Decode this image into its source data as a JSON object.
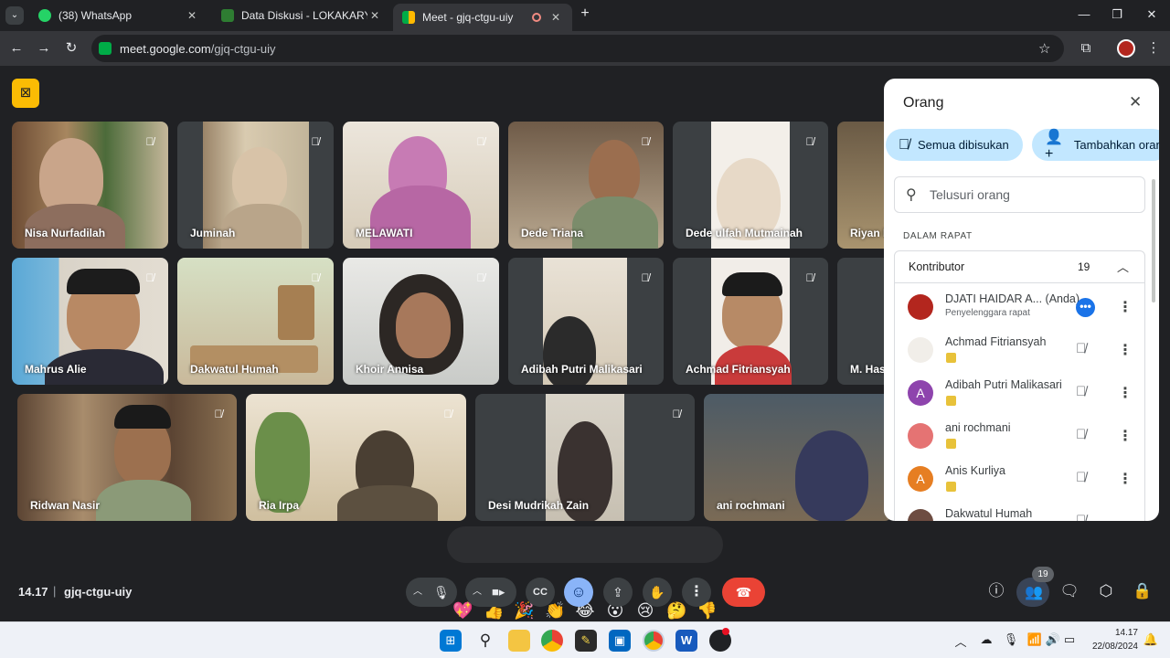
{
  "browser": {
    "tabs": [
      {
        "label": "(38) WhatsApp",
        "icon": "whatsapp-icon",
        "color": "#25d366"
      },
      {
        "label": "Data Diskusi - LOKAKARYA",
        "icon": "lokakarya-icon",
        "color": "#2e7d32"
      },
      {
        "label": "Meet - gjq-ctgu-uiy",
        "icon": "meet-icon",
        "color": "#00ac47"
      }
    ],
    "url_host": "meet.google.com",
    "url_path": "/gjq-ctgu-uiy"
  },
  "meet": {
    "accent": "#8ab4f8",
    "time": "14.17",
    "separator": "|",
    "meeting_code": "gjq-ctgu-uiy",
    "participant_count": "19",
    "participants": [
      {
        "name": "Nisa Nurfadilah",
        "muted": true
      },
      {
        "name": "Juminah",
        "muted": true
      },
      {
        "name": "MELAWATI",
        "muted": true
      },
      {
        "name": "Dede Triana",
        "muted": true
      },
      {
        "name": "Dede ulfah Mutmainah",
        "muted": true
      },
      {
        "name": "Riyan D",
        "muted": false
      },
      {
        "name": "Mahrus Alie",
        "muted": true
      },
      {
        "name": "Dakwatul Humah",
        "muted": true
      },
      {
        "name": "Khoir Annisa",
        "muted": true
      },
      {
        "name": "Adibah Putri Malikasari",
        "muted": true
      },
      {
        "name": "Achmad Fitriansyah",
        "muted": true
      },
      {
        "name": "M. Hasy",
        "muted": false
      },
      {
        "name": "Ridwan Nasir",
        "muted": true
      },
      {
        "name": "Ria Irpa",
        "muted": true
      },
      {
        "name": "Desi Mudrikah Zain",
        "muted": true
      },
      {
        "name": "ani rochmani",
        "muted": false
      }
    ],
    "reactions": [
      "💖",
      "👍",
      "🎉",
      "👏",
      "😂",
      "😮",
      "😢",
      "🤔",
      "👎"
    ]
  },
  "people_panel": {
    "title": "Orang",
    "mute_all_label": "Semua dibisukan",
    "add_people_label": "Tambahkan orang",
    "search_placeholder": "Telusuri orang",
    "section_label": "DALAM RAPAT",
    "group_label": "Kontributor",
    "group_count": "19",
    "rows": [
      {
        "name": "DJATI HAIDAR A...",
        "you": "(Anda)",
        "sub": "Penyelenggara rapat",
        "avatar_color": "#b3261e",
        "initial": ""
      },
      {
        "name": "Achmad Fitriansyah",
        "avatar_color": "#e8e4dc",
        "initial": ""
      },
      {
        "name": "Adibah Putri Malikasari",
        "avatar_color": "#8e44ad",
        "initial": "A"
      },
      {
        "name": "ani rochmani",
        "avatar_color": "#c0392b",
        "initial": ""
      },
      {
        "name": "Anis Kurliya",
        "avatar_color": "#e67e22",
        "initial": "A"
      },
      {
        "name": "Dakwatul Humah",
        "avatar_color": "#6d4c41",
        "initial": ""
      }
    ]
  },
  "taskbar": {
    "time": "14.17",
    "date": "22/08/2024"
  }
}
